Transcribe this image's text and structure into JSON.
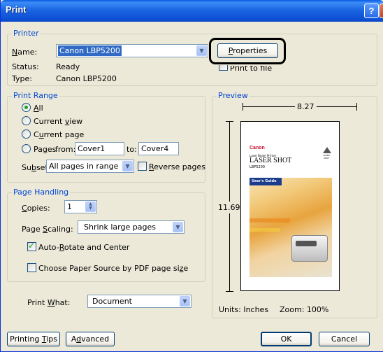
{
  "window": {
    "title": "Print",
    "help_label": "?",
    "close_label": "X"
  },
  "printer": {
    "group_label": "Printer",
    "name_label": "Name:",
    "name_value": "Canon LBP5200",
    "properties_label": "Properties",
    "status_label": "Status:",
    "status_value": "Ready",
    "type_label": "Type:",
    "type_value": "Canon LBP5200",
    "print_to_file_label": "Print to file"
  },
  "print_range": {
    "group_label": "Print Range",
    "all_label": "All",
    "current_view_label": "Current view",
    "current_page_label": "Current page",
    "pages_label": "Pages",
    "from_label": "from:",
    "from_value": "Cover1",
    "to_label": "to:",
    "to_value": "Cover4",
    "subset_label": "Subset:",
    "subset_value": "All pages in range",
    "reverse_pages_label": "Reverse pages",
    "selected": "All"
  },
  "page_handling": {
    "group_label": "Page Handling",
    "copies_label": "Copies:",
    "copies_value": "1",
    "scaling_label": "Page Scaling:",
    "scaling_value": "Shrink large pages",
    "auto_rotate_label": "Auto-Rotate and Center",
    "auto_rotate_checked": true,
    "choose_source_label": "Choose Paper Source by PDF page size",
    "choose_source_checked": false
  },
  "print_what": {
    "label": "Print What:",
    "value": "Document"
  },
  "preview": {
    "group_label": "Preview",
    "width_value": "8.27",
    "height_value": "11.69",
    "units_label": "Units: Inches",
    "zoom_label": "Zoom: 100%",
    "doc_brand": "Canon",
    "doc_subtitle": "Laser Beam Printer",
    "doc_title": "LASER SHOT",
    "doc_model": "LBP5200",
    "doc_guide": "User's Guide",
    "doc_logo": "LASER SHOT"
  },
  "buttons": {
    "printing_tips": "Printing Tips",
    "advanced": "Advanced",
    "ok": "OK",
    "cancel": "Cancel"
  }
}
